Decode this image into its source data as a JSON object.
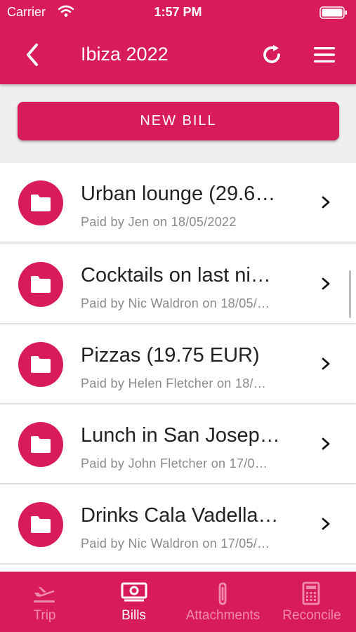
{
  "status_bar": {
    "carrier": "Carrier",
    "time": "1:57 PM"
  },
  "nav": {
    "title": "Ibiza 2022"
  },
  "new_bill": {
    "label": "NEW BILL"
  },
  "bills": [
    {
      "name": "Urban lounge (29.6…",
      "paid": "Paid by Jen on 18/05/2022"
    },
    {
      "name": "Cocktails on last ni…",
      "paid": "Paid by Nic Waldron on 18/05/…"
    },
    {
      "name": "Pizzas (19.75 EUR)",
      "paid": "Paid by Helen Fletcher on 18/…"
    },
    {
      "name": "Lunch in San Josep…",
      "paid": "Paid by John Fletcher on 17/0…"
    },
    {
      "name": "Drinks Cala Vadella…",
      "paid": "Paid by Nic Waldron on 17/05/…"
    }
  ],
  "tabs": [
    {
      "label": "Trip",
      "icon": "plane-icon",
      "active": false
    },
    {
      "label": "Bills",
      "icon": "money-icon",
      "active": true
    },
    {
      "label": "Attachments",
      "icon": "paperclip-icon",
      "active": false
    },
    {
      "label": "Reconcile",
      "icon": "calculator-icon",
      "active": false
    }
  ],
  "colors": {
    "primary": "#d81b5a",
    "inactive_tab": "#f08bab",
    "background": "#efefef"
  }
}
